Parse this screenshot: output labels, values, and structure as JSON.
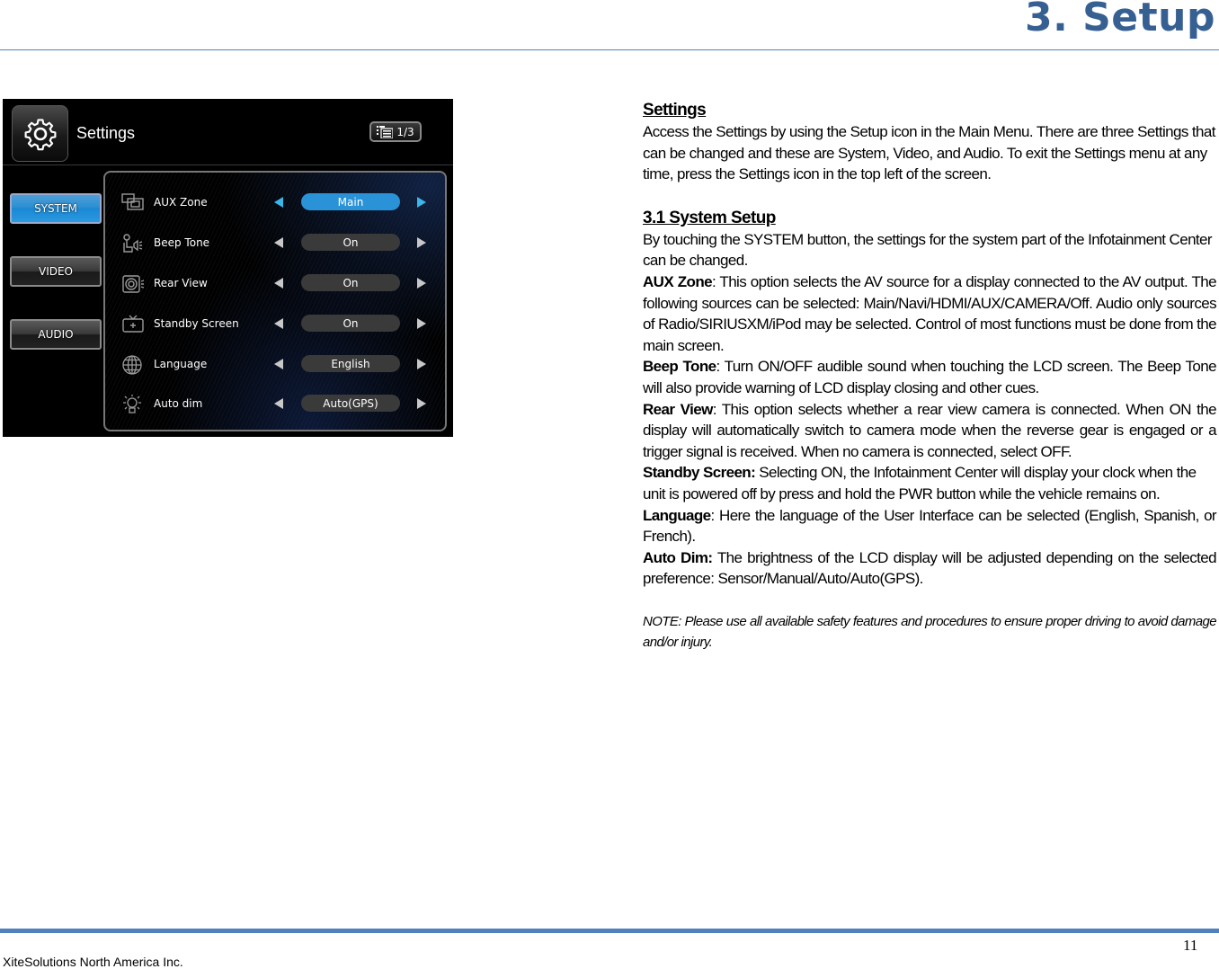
{
  "header": {
    "chapter_title": "3. Setup"
  },
  "device_screen": {
    "title": "Settings",
    "page_indicator": "1/3",
    "tabs": [
      {
        "label": "SYSTEM",
        "active": true
      },
      {
        "label": "VIDEO",
        "active": false
      },
      {
        "label": "AUDIO",
        "active": false
      }
    ],
    "settings": [
      {
        "icon": "aux-zone-icon",
        "label": "AUX Zone",
        "value": "Main",
        "active": true
      },
      {
        "icon": "beep-tone-icon",
        "label": "Beep Tone",
        "value": "On",
        "active": false
      },
      {
        "icon": "rear-view-camera-icon",
        "label": "Rear View",
        "value": "On",
        "active": false
      },
      {
        "icon": "standby-screen-tv-icon",
        "label": "Standby Screen",
        "value": "On",
        "active": false
      },
      {
        "icon": "language-globe-icon",
        "label": "Language",
        "value": "English",
        "active": false
      },
      {
        "icon": "auto-dim-bulb-icon",
        "label": "Auto dim",
        "value": "Auto(GPS)",
        "active": false
      }
    ],
    "colors": {
      "active_accent": "#2a93d8",
      "arrow_active": "#3bb6e8"
    }
  },
  "content": {
    "settings_heading": "Settings",
    "settings_intro": "Access the Settings by using the Setup icon in the Main Menu. There are three Settings that can be changed and these are System, Video, and Audio. To exit the Settings menu at any time, press the Settings icon in the top left of the screen.",
    "system_heading": "3.1 System Setup",
    "system_intro": "By touching the SYSTEM button, the settings for the system part of the Infotainment Center can be changed.",
    "items": [
      {
        "term": "AUX Zone",
        "sep": ": ",
        "text": "This option selects the AV source for a display connected to the AV output. The following sources can be selected: Main/Navi/HDMI/AUX/CAMERA/Off. Audio only sources of Radio/SIRIUSXM/iPod may be selected. Control of most functions must be done from the main screen."
      },
      {
        "term": "Beep Tone",
        "sep": ": ",
        "text": "Turn ON/OFF audible sound when touching the LCD screen. The Beep Tone will also provide warning of LCD display closing and other cues."
      },
      {
        "term": "Rear View",
        "sep": ": ",
        "text": "This option selects whether a rear view camera is connected. When ON the display will automatically switch to camera mode when the reverse gear is engaged or a trigger signal is received. When no camera is connected, select OFF."
      },
      {
        "term": "Standby Screen:",
        "sep": " ",
        "text": "Selecting ON, the Infotainment Center will display your clock when the unit is powered off by press and hold the PWR button while the vehicle remains on."
      },
      {
        "term": "Language",
        "sep": ": ",
        "text": "Here the language of the User Interface can be selected (English, Spanish, or French)."
      },
      {
        "term": "Auto Dim:",
        "sep": " ",
        "text": "The brightness of the LCD display will be adjusted depending on the selected preference: Sensor/Manual/Auto/Auto(GPS)."
      }
    ],
    "note": "NOTE: Please use all available safety features and procedures to ensure proper driving to avoid damage and/or injury."
  },
  "footer": {
    "page_number": "11",
    "company": "XiteSolutions North America Inc."
  },
  "colors": {
    "heading_blue": "#376092",
    "rule_blue": "#4f81bd"
  }
}
